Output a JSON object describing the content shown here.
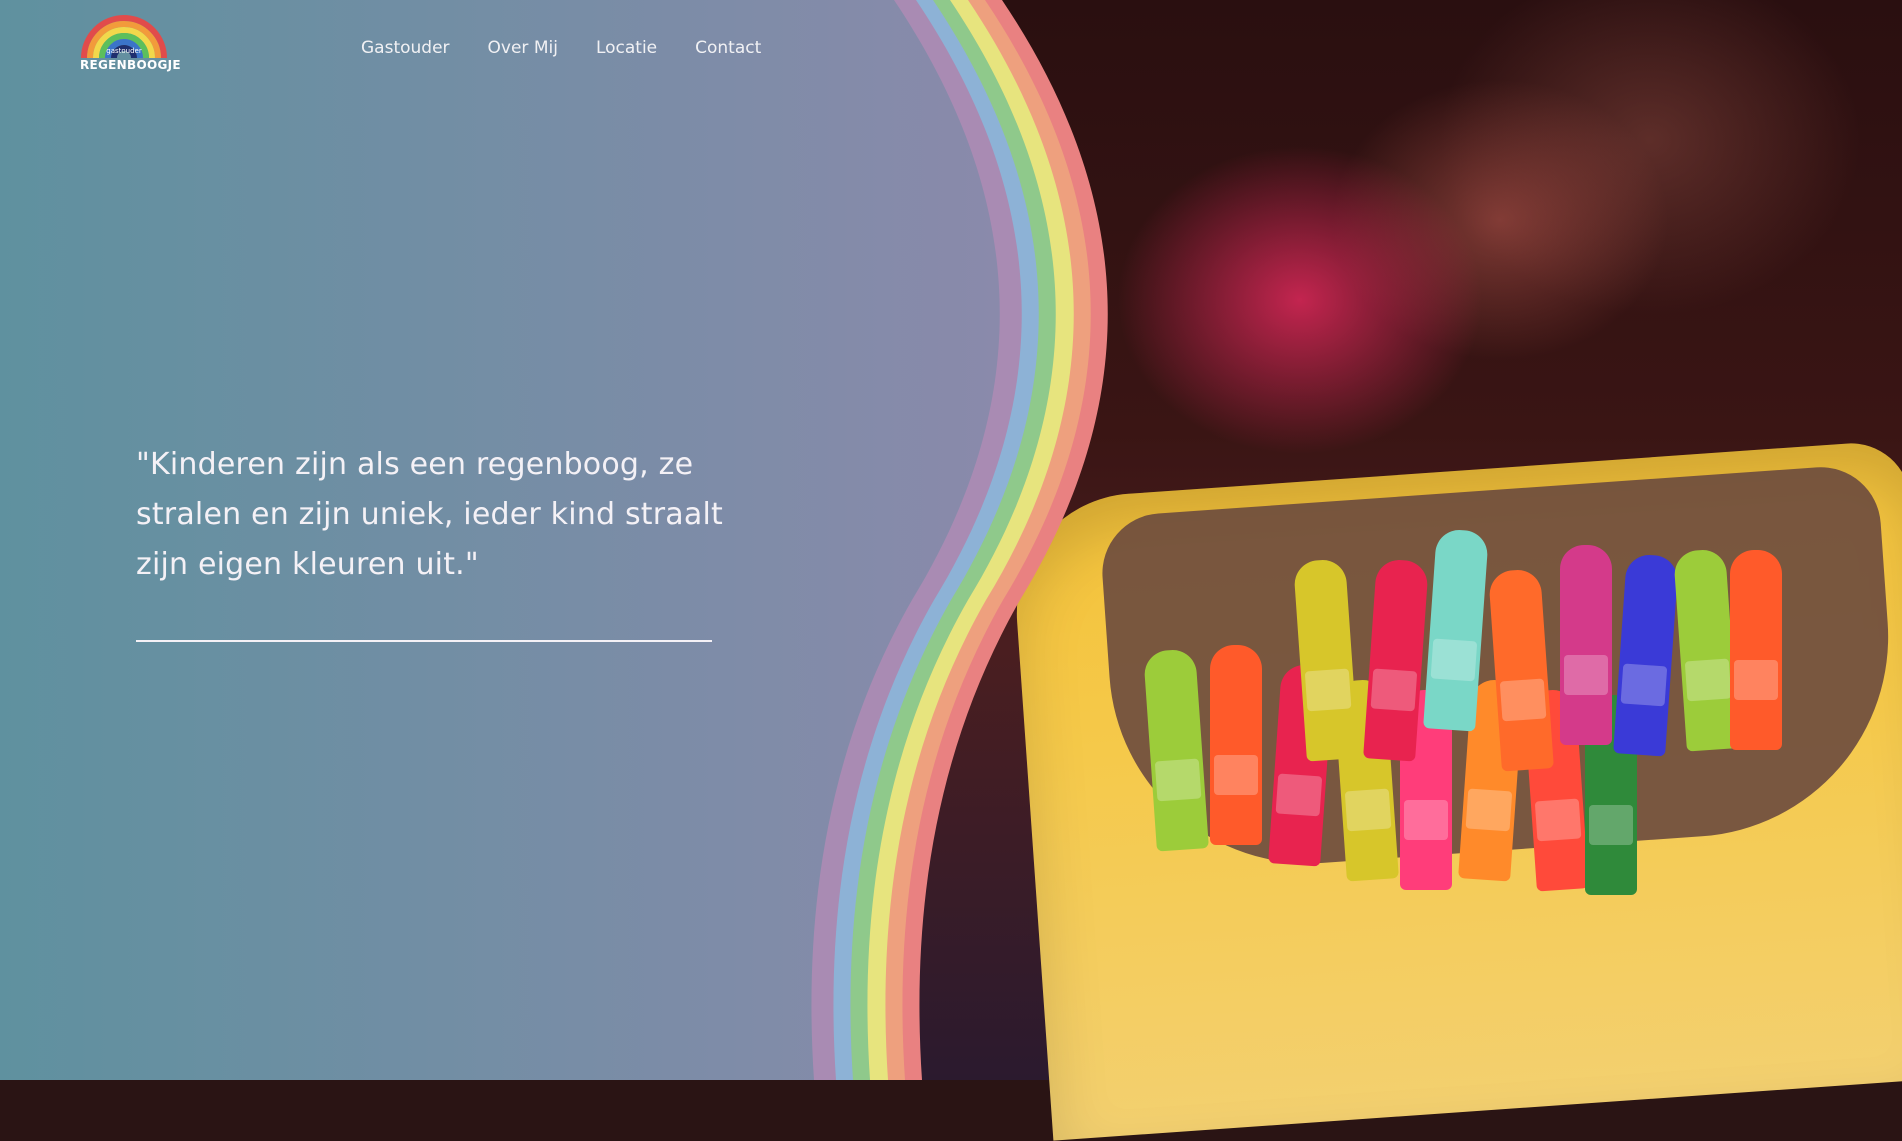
{
  "logo": {
    "name": "REGENBOOGJE",
    "subtitle": "gastouder",
    "icon": "rainbow-icon"
  },
  "nav": {
    "items": [
      {
        "label": "Gastouder"
      },
      {
        "label": "Over Mij"
      },
      {
        "label": "Locatie"
      },
      {
        "label": "Contact"
      }
    ]
  },
  "hero": {
    "quote": "\"Kinderen zijn als een regenboog, ze stralen en zijn uniek, ieder kind straalt zijn eigen kleuren uit.\"",
    "image": "crayons-photo"
  },
  "colors": {
    "panel_start": "#5f919f",
    "panel_end": "#8a8aab",
    "stripes": [
      "#a98bb3",
      "#8db2d6",
      "#8fc98b",
      "#e7e47e",
      "#eea07e",
      "#e98181"
    ],
    "text": "#f4f1f6"
  }
}
